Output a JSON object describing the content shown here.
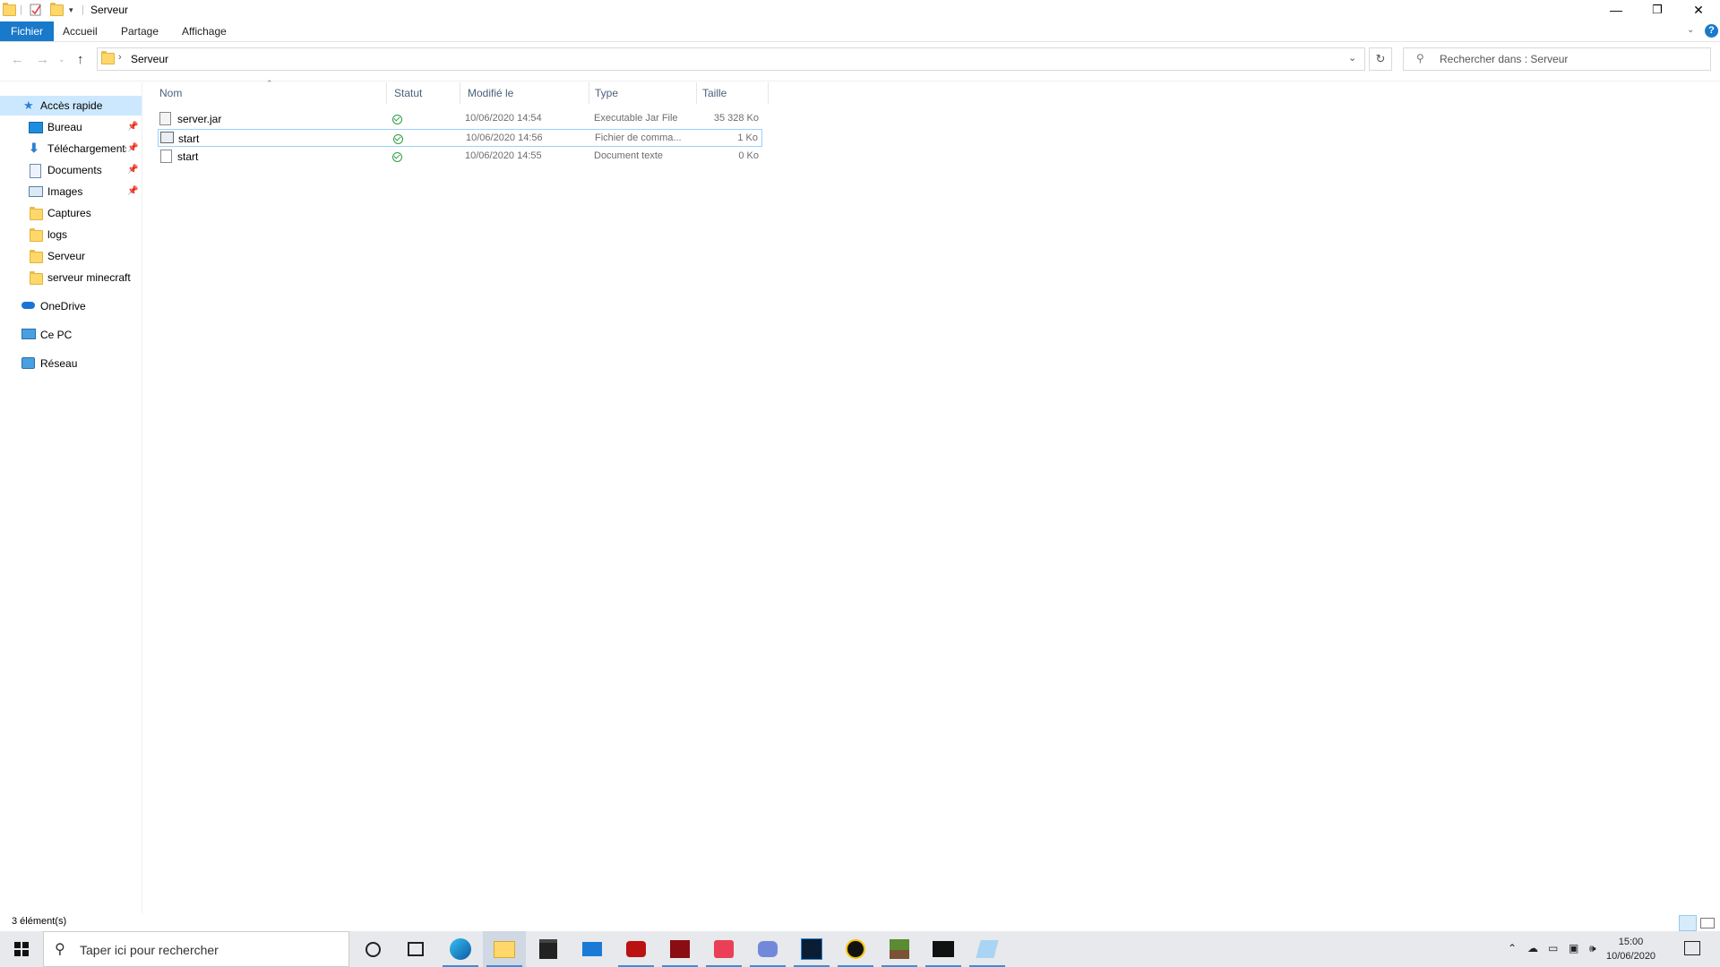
{
  "window": {
    "title": "Serveur",
    "minimize": "—",
    "restore": "❐",
    "close": "✕"
  },
  "ribbon": {
    "tabs": [
      "Fichier",
      "Accueil",
      "Partage",
      "Affichage"
    ]
  },
  "address": {
    "path": "Serveur",
    "search_placeholder": "Rechercher dans : Serveur"
  },
  "nav": {
    "quick_access": "Accès rapide",
    "items": [
      "Bureau",
      "Téléchargements",
      "Documents",
      "Images",
      "Captures",
      "logs",
      "Serveur",
      "serveur minecraft"
    ],
    "onedrive": "OneDrive",
    "this_pc": "Ce PC",
    "network": "Réseau"
  },
  "columns": [
    "Nom",
    "Statut",
    "Modifié le",
    "Type",
    "Taille"
  ],
  "files": [
    {
      "name": "server.jar",
      "modified": "10/06/2020 14:54",
      "type": "Executable Jar File",
      "size": "35 328 Ko"
    },
    {
      "name": "start",
      "modified": "10/06/2020 14:56",
      "type": "Fichier de comma...",
      "size": "1 Ko"
    },
    {
      "name": "start",
      "modified": "10/06/2020 14:55",
      "type": "Document texte",
      "size": "0 Ko"
    }
  ],
  "status": {
    "count": "3 élément(s)"
  },
  "taskbar": {
    "search_placeholder": "Taper ici pour rechercher",
    "time": "15:00",
    "date": "10/06/2020"
  },
  "colors": {
    "accent": "#1979ca",
    "selection": "#cce8ff",
    "status_ok": "#2e9e3f"
  }
}
